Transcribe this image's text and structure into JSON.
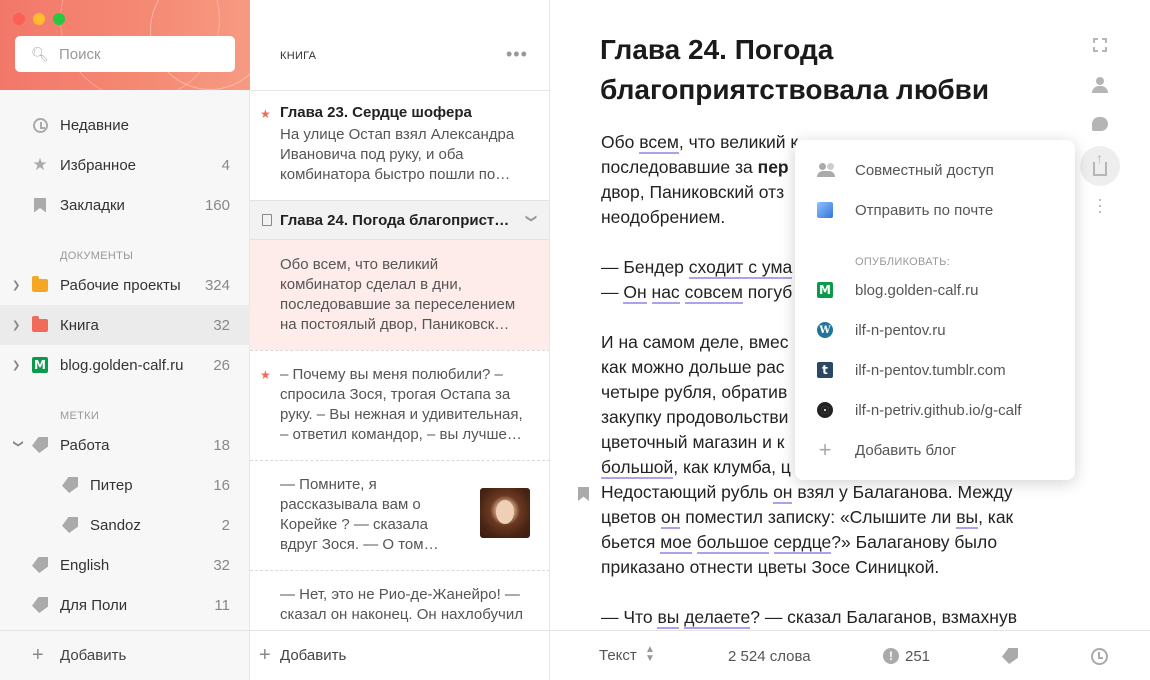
{
  "colors": {
    "accent": "#f3786a",
    "underline": "#a9a4ea",
    "wordpress": "#21759b",
    "tumblr": "#2c4762",
    "blog_green": "#0a9b4a"
  },
  "search": {
    "placeholder": "Поиск"
  },
  "sidebar": {
    "items": [
      {
        "label": "Недавние",
        "icon": "clock-icon"
      },
      {
        "label": "Избранное",
        "count": "4",
        "icon": "star-icon"
      },
      {
        "label": "Закладки",
        "count": "160",
        "icon": "bookmark-icon"
      }
    ],
    "documents_header": "ДОКУМЕНТЫ",
    "documents": [
      {
        "label": "Рабочие проекты",
        "count": "324",
        "icon": "folder-icon",
        "color": "#f5a623"
      },
      {
        "label": "Книга",
        "count": "32",
        "icon": "folder-icon",
        "color": "#f06b5a"
      },
      {
        "label": "blog.golden-calf.ru",
        "count": "26",
        "icon": "medium-icon"
      }
    ],
    "tags_header": "МЕТКИ",
    "tags": [
      {
        "label": "Работа",
        "count": "18"
      },
      {
        "label": "Питер",
        "count": "16"
      },
      {
        "label": "Sandoz",
        "count": "2"
      },
      {
        "label": "English",
        "count": "32"
      },
      {
        "label": "Для Поли",
        "count": "11"
      }
    ],
    "add_label": "Добавить"
  },
  "list": {
    "title": "КНИГА",
    "more": "•••",
    "notes": [
      {
        "title": "Глава 23. Сердце шофера",
        "snippet_lines": [
          "На улице Остап взял Александра",
          "Ивановича под руку, и оба",
          "комбинатора быстро пошли по…"
        ]
      },
      {
        "title": "Глава 24. Погода благоприст…"
      },
      {
        "snippet_lines": [
          "Обо всем, что великий",
          "комбинатор сделал в дни,",
          "последовавшие за переселением",
          "на постоялый двор, Паниковск…"
        ]
      },
      {
        "snippet_lines": [
          "– Почему вы меня полюбили? –",
          "спросила Зося, трогая Остапа за",
          "руку. – Вы нежная и удивительная,",
          "– ответил командор, – вы лучше…"
        ]
      },
      {
        "snippet_lines": [
          "— Помните, я",
          "рассказывала вам о",
          "Корейке ? — сказала",
          "вдруг Зося. — О том…"
        ]
      },
      {
        "snippet_lines": [
          "— Нет, это не Рио-де-Жанейро! —",
          "сказал он наконец. Он нахлобучил"
        ]
      }
    ],
    "add_label": "Добавить"
  },
  "editor": {
    "title": "Глава 24. Погода благоприятствовала любви",
    "footer": {
      "mode": "Текст",
      "words": "2 524 слова",
      "warnings": "251"
    }
  },
  "share": {
    "items": [
      {
        "label": "Совместный доступ",
        "icon": "people-icon"
      },
      {
        "label": "Отправить по почте",
        "icon": "mail-icon"
      }
    ],
    "publish_header": "ОПУБЛИКОВАТЬ:",
    "blogs": [
      {
        "label": "blog.golden-calf.ru",
        "icon": "medium-icon"
      },
      {
        "label": "ilf-n-pentov.ru",
        "icon": "wordpress-icon"
      },
      {
        "label": "ilf-n-pentov.tumblr.com",
        "icon": "tumblr-icon"
      },
      {
        "label": "ilf-n-petriv.github.io/g-calf",
        "icon": "github-icon"
      }
    ],
    "add_blog": "Добавить блог"
  }
}
